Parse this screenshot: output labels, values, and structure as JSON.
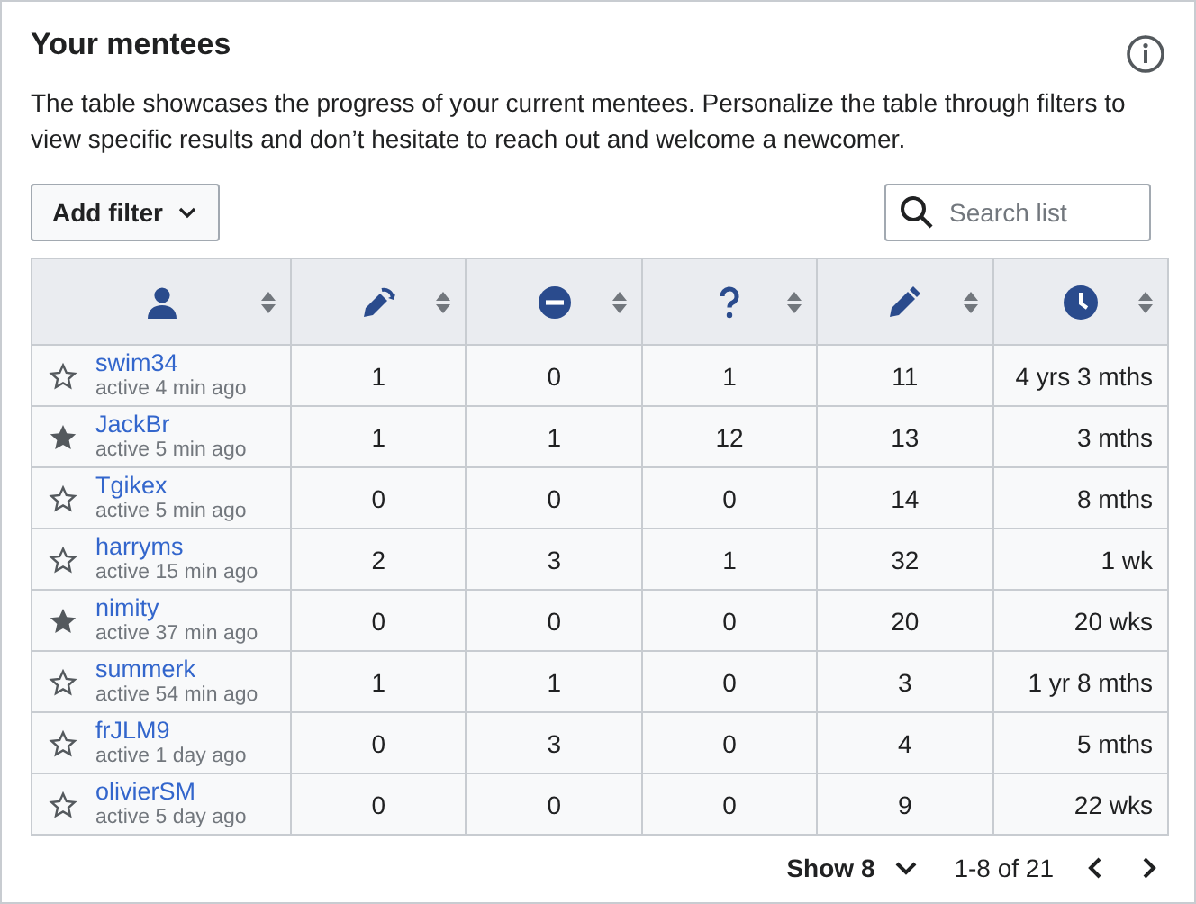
{
  "title": "Your mentees",
  "description": "The table showcases the progress of your current mentees. Personalize the table through filters to view specific results and don’t hesitate to reach out and welcome a newcomer.",
  "filter_button": "Add filter",
  "search": {
    "placeholder": "Search list"
  },
  "table": {
    "columns": [
      {
        "kind": "user"
      },
      {
        "kind": "revert"
      },
      {
        "kind": "blocked"
      },
      {
        "kind": "question"
      },
      {
        "kind": "edit"
      },
      {
        "kind": "clock"
      }
    ],
    "rows": [
      {
        "name": "swim34",
        "activity": "active 4 min ago",
        "starred": false,
        "cells": [
          "1",
          "0",
          "1",
          "11",
          "4 yrs 3 mths"
        ]
      },
      {
        "name": "JackBr",
        "activity": "active 5 min ago",
        "starred": true,
        "cells": [
          "1",
          "1",
          "12",
          "13",
          "3 mths"
        ]
      },
      {
        "name": "Tgikex",
        "activity": "active 5 min ago",
        "starred": false,
        "cells": [
          "0",
          "0",
          "0",
          "14",
          "8 mths"
        ]
      },
      {
        "name": "harryms",
        "activity": "active 15 min ago",
        "starred": false,
        "cells": [
          "2",
          "3",
          "1",
          "32",
          "1 wk"
        ]
      },
      {
        "name": "nimity",
        "activity": "active 37 min ago",
        "starred": true,
        "cells": [
          "0",
          "0",
          "0",
          "20",
          "20 wks"
        ]
      },
      {
        "name": "summerk",
        "activity": "active 54 min ago",
        "starred": false,
        "cells": [
          "1",
          "1",
          "0",
          "3",
          "1 yr 8 mths"
        ]
      },
      {
        "name": "frJLM9",
        "activity": "active 1 day ago",
        "starred": false,
        "cells": [
          "0",
          "3",
          "0",
          "4",
          "5 mths"
        ]
      },
      {
        "name": "olivierSM",
        "activity": "active 5 day ago",
        "starred": false,
        "cells": [
          "0",
          "0",
          "0",
          "9",
          "22 wks"
        ]
      }
    ]
  },
  "pagination": {
    "page_size": "Show 8",
    "range": "1-8 of 21"
  }
}
